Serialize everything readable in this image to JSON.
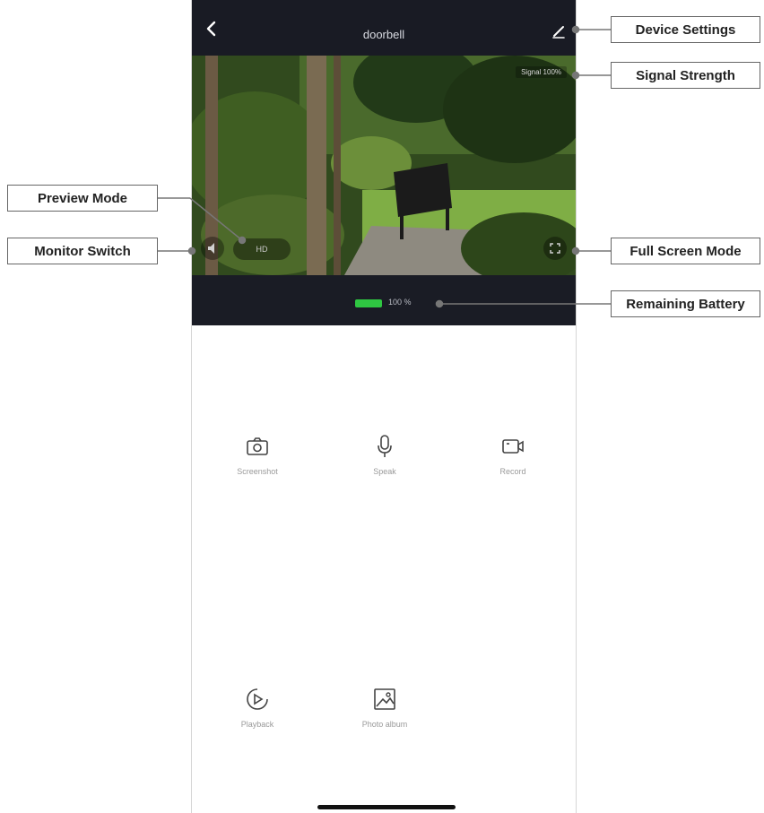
{
  "app": {
    "title": "doorbell",
    "signal_text": "Signal 100%",
    "preview_mode_label": "HD",
    "battery_text": "100 %",
    "battery_level": 1.0,
    "battery_color": "#2fc742"
  },
  "actions": [
    {
      "label": "Screenshot",
      "icon": "camera-icon"
    },
    {
      "label": "Speak",
      "icon": "microphone-icon"
    },
    {
      "label": "Record",
      "icon": "video-record-icon"
    },
    {
      "label": "Playback",
      "icon": "playback-icon"
    },
    {
      "label": "Photo album",
      "icon": "photo-album-icon"
    }
  ],
  "callouts": {
    "device_settings": "Device Settings",
    "signal_strength": "Signal Strength",
    "preview_mode": "Preview Mode",
    "monitor_switch": "Monitor Switch",
    "full_screen_mode": "Full Screen Mode",
    "remaining_battery": "Remaining Battery"
  },
  "colors": {
    "topbar_bg": "#191b24",
    "callout_line": "#777777"
  }
}
